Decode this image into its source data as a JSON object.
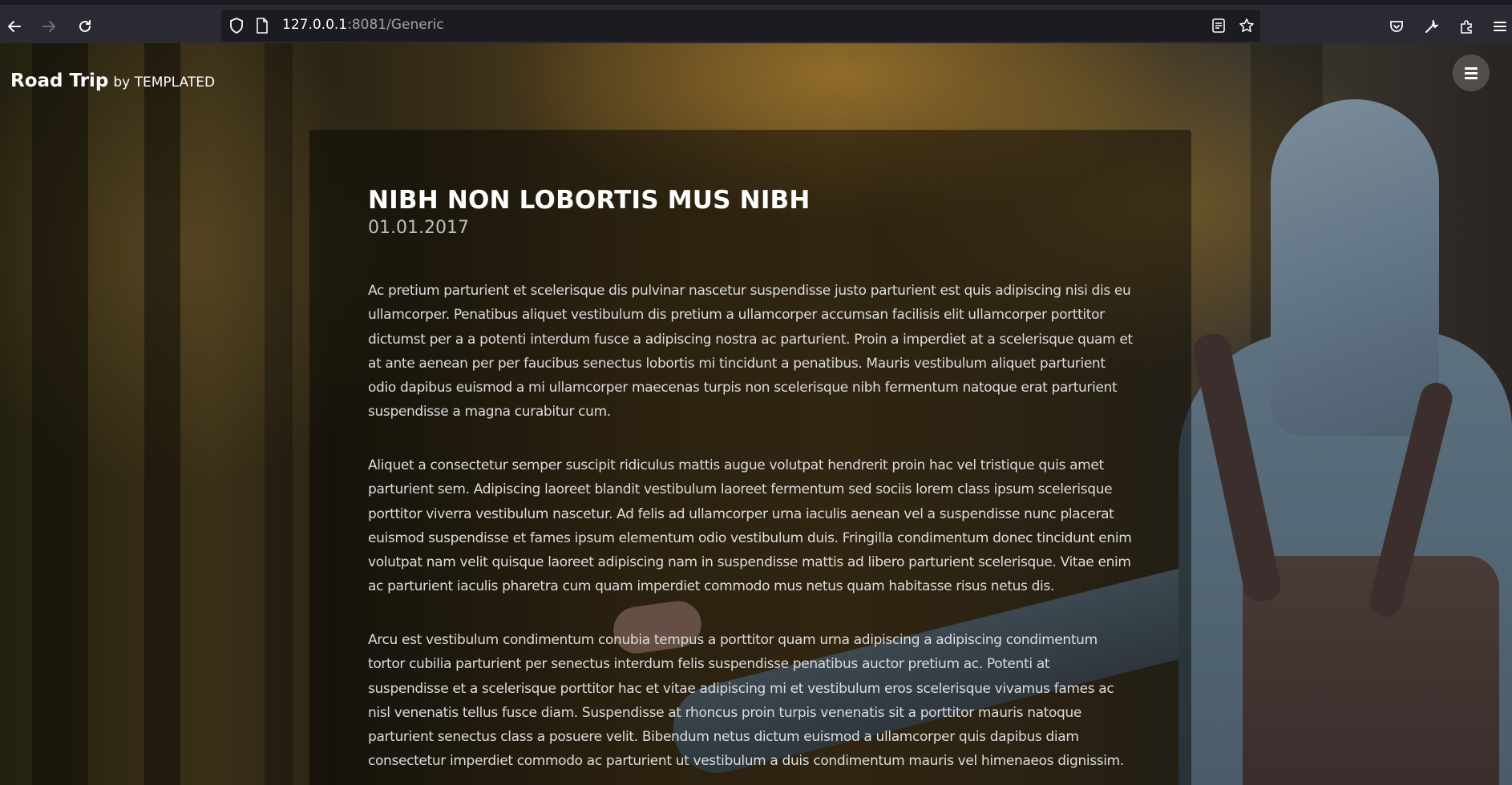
{
  "browser": {
    "url_host": "127.0.0.1",
    "url_path": ":8081/Generic",
    "icons": {
      "back": "arrow-left-icon",
      "forward": "arrow-right-icon",
      "reload": "reload-icon",
      "site_info": "shield-icon",
      "page": "page-icon",
      "reader": "reader-view-icon",
      "bookmark": "star-icon",
      "pocket": "pocket-icon",
      "devtools": "wrench-icon",
      "extensions": "puzzle-icon",
      "menu": "hamburger-icon"
    }
  },
  "header": {
    "brand": "Road Trip",
    "by": "by TEMPLATED"
  },
  "post": {
    "title": "NIBH NON LOBORTIS MUS NIBH",
    "date": "01.01.2017",
    "paragraphs": [
      "Ac pretium parturient et scelerisque dis pulvinar nascetur suspendisse justo parturient est quis adipiscing nisi dis eu ullamcorper. Penatibus aliquet vestibulum dis pretium a ullamcorper accumsan facilisis elit ullamcorper porttitor dictumst per a a potenti interdum fusce a adipiscing nostra ac parturient. Proin a imperdiet at a scelerisque quam et at ante aenean per per faucibus senectus lobortis mi tincidunt a penatibus. Mauris vestibulum aliquet parturient odio dapibus euismod a mi ullamcorper maecenas turpis non scelerisque nibh fermentum natoque erat parturient suspendisse a magna curabitur cum.",
      "Aliquet a consectetur semper suscipit ridiculus mattis augue volutpat hendrerit proin hac vel tristique quis amet parturient sem. Adipiscing laoreet blandit vestibulum laoreet fermentum sed sociis lorem class ipsum scelerisque porttitor viverra vestibulum nascetur. Ad felis ad ullamcorper urna iaculis aenean vel a suspendisse nunc placerat euismod suspendisse et fames ipsum elementum odio vestibulum duis. Fringilla condimentum donec tincidunt enim volutpat nam velit quisque laoreet adipiscing nam in suspendisse mattis ad libero parturient scelerisque. Vitae enim ac parturient iaculis pharetra cum quam imperdiet commodo mus netus quam habitasse risus netus dis.",
      "Arcu est vestibulum condimentum conubia tempus a porttitor quam urna adipiscing a adipiscing condimentum tortor cubilia parturient per senectus interdum felis suspendisse penatibus auctor pretium ac. Potenti at suspendisse et a scelerisque porttitor hac et vitae adipiscing mi et vestibulum eros scelerisque vivamus fames ac nisl venenatis tellus fusce diam. Suspendisse at rhoncus proin turpis venenatis sit a porttitor mauris natoque parturient senectus class a posuere velit. Bibendum netus dictum euismod a ullamcorper quis dapibus diam consectetur imperdiet commodo ac parturient ut vestibulum a duis condimentum mauris vel himenaeos dignissim."
    ]
  },
  "colors": {
    "chrome_bg": "#2b2a33",
    "urlbar_bg": "#1c1b22",
    "panel_overlay": "rgba(0,0,0,0.45)",
    "title": "#ffffff",
    "body_text": "#dcdcdc"
  }
}
